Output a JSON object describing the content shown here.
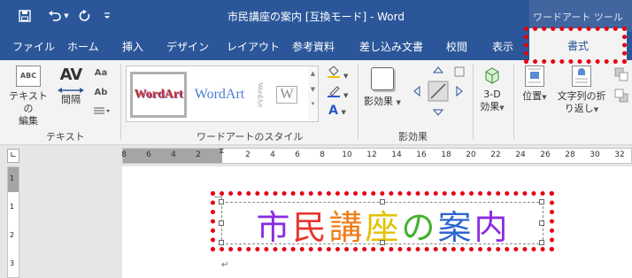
{
  "title_bar": {
    "window_title": "市民講座の案内 [互換モード] - Word",
    "context_tab_title": "ワードアート ツール"
  },
  "tabs": [
    {
      "label": "ファイル"
    },
    {
      "label": "ホーム"
    },
    {
      "label": "挿入"
    },
    {
      "label": "デザイン"
    },
    {
      "label": "レイアウト"
    },
    {
      "label": "参考資料"
    },
    {
      "label": "差し込み文書"
    },
    {
      "label": "校閲"
    },
    {
      "label": "表示"
    },
    {
      "label": "書式",
      "active": true
    }
  ],
  "ribbon": {
    "text_group": {
      "label": "テキスト",
      "edit_text_line1": "テキストの",
      "edit_text_line2": "編集",
      "spacing_label": "間隔",
      "spacing_icon_text": "AV",
      "edit_icon_text": "ABC"
    },
    "wordart_styles_group": {
      "label": "ワードアートのスタイル",
      "gallery": [
        "WordArt",
        "WordArt",
        "WordArt",
        "W"
      ]
    },
    "shadow_group": {
      "label": "影効果",
      "shadow_button": "影効果"
    },
    "3d_group": {
      "label1": "3-D",
      "label2": "効果"
    },
    "arrange": {
      "position_label": "位置",
      "wrap_line1": "文字列の折",
      "wrap_line2": "り返し"
    }
  },
  "ruler": {
    "left_ticks": [
      "8",
      "6",
      "4",
      "2"
    ],
    "right_ticks": [
      "2",
      "4",
      "6",
      "8",
      "10",
      "12",
      "14",
      "16",
      "18",
      "20",
      "22",
      "24",
      "26",
      "28",
      "30",
      "32"
    ],
    "vertical_ticks": [
      "1",
      "1",
      "2",
      "3"
    ]
  },
  "document": {
    "wordart_chars": [
      "市",
      "民",
      "講",
      "座",
      "の",
      "案",
      "内"
    ],
    "wordart_colors": [
      "#8a2be2",
      "#e8342f",
      "#ef7d1a",
      "#e3c200",
      "#44b030",
      "#2f66d0",
      "#8a2be2"
    ],
    "paragraph_mark": "↵"
  },
  "colors": {
    "title_bar": "#2b579a",
    "highlight": "#e60012"
  }
}
